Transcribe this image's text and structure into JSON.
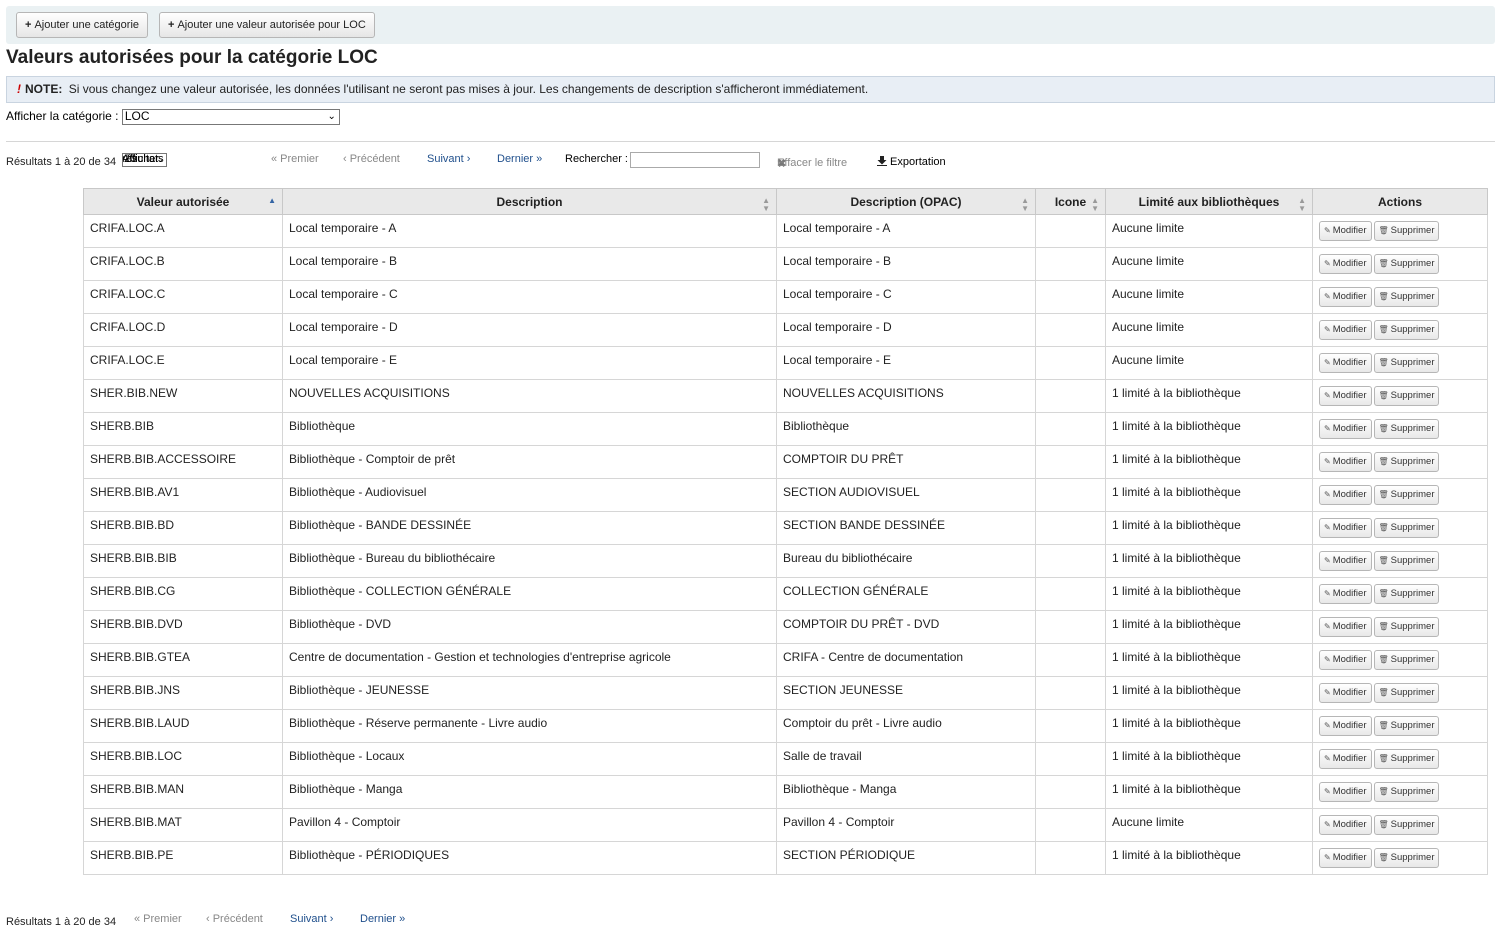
{
  "toolbar": {
    "add_category": "Ajouter une catégorie",
    "add_value": "Ajouter une valeur autorisée pour LOC"
  },
  "page_title": "Valeurs autorisées pour la catégorie LOC",
  "note": {
    "label": "NOTE:",
    "text": "Si vous changez une valeur autorisée, les données l'utilisant ne seront pas mises à jour. Les changements de description s'afficheront immédiatement."
  },
  "category": {
    "label": "Afficher la catégorie :",
    "selected": "LOC"
  },
  "pager": {
    "info": "Résultats 1 à 20 de 34",
    "show_label": "Afficher",
    "page_length": "20",
    "results_label": "résultats",
    "first": "« Premier",
    "previous": "‹ Précédent",
    "next": "Suivant ›",
    "last": "Dernier »",
    "search_label": "Rechercher :",
    "search_value": "",
    "clear_filter": "Effacer le filtre",
    "export": "Exportation"
  },
  "table": {
    "headers": [
      "Valeur autorisée",
      "Description",
      "Description (OPAC)",
      "Icone",
      "Limité aux bibliothèques",
      "Actions"
    ],
    "edit_label": "Modifier",
    "delete_label": "Supprimer",
    "rows": [
      [
        "CRIFA.LOC.A",
        "Local temporaire - A",
        "Local temporaire - A",
        "",
        "Aucune limite"
      ],
      [
        "CRIFA.LOC.B",
        "Local temporaire - B",
        "Local temporaire - B",
        "",
        "Aucune limite"
      ],
      [
        "CRIFA.LOC.C",
        "Local temporaire - C",
        "Local temporaire - C",
        "",
        "Aucune limite"
      ],
      [
        "CRIFA.LOC.D",
        "Local temporaire - D",
        "Local temporaire - D",
        "",
        "Aucune limite"
      ],
      [
        "CRIFA.LOC.E",
        "Local temporaire - E",
        "Local temporaire - E",
        "",
        "Aucune limite"
      ],
      [
        "SHER.BIB.NEW",
        "NOUVELLES ACQUISITIONS",
        "NOUVELLES ACQUISITIONS",
        "",
        "1 limité à la bibliothèque"
      ],
      [
        "SHERB.BIB",
        "Bibliothèque",
        "Bibliothèque",
        "",
        "1 limité à la bibliothèque"
      ],
      [
        "SHERB.BIB.ACCESSOIRE",
        "Bibliothèque - Comptoir de prêt",
        "COMPTOIR DU PRÊT",
        "",
        "1 limité à la bibliothèque"
      ],
      [
        "SHERB.BIB.AV1",
        "Bibliothèque - Audiovisuel",
        "SECTION AUDIOVISUEL",
        "",
        "1 limité à la bibliothèque"
      ],
      [
        "SHERB.BIB.BD",
        "Bibliothèque - BANDE DESSINÉE",
        "SECTION BANDE DESSINÉE",
        "",
        "1 limité à la bibliothèque"
      ],
      [
        "SHERB.BIB.BIB",
        "Bibliothèque - Bureau du bibliothécaire",
        "Bureau du bibliothécaire",
        "",
        "1 limité à la bibliothèque"
      ],
      [
        "SHERB.BIB.CG",
        "Bibliothèque - COLLECTION GÉNÉRALE",
        "COLLECTION GÉNÉRALE",
        "",
        "1 limité à la bibliothèque"
      ],
      [
        "SHERB.BIB.DVD",
        "Bibliothèque - DVD",
        "COMPTOIR DU PRÊT - DVD",
        "",
        "1 limité à la bibliothèque"
      ],
      [
        "SHERB.BIB.GTEA",
        "Centre de documentation - Gestion et technologies d'entreprise agricole",
        "CRIFA - Centre de documentation",
        "",
        "1 limité à la bibliothèque"
      ],
      [
        "SHERB.BIB.JNS",
        "Bibliothèque - JEUNESSE",
        "SECTION JEUNESSE",
        "",
        "1 limité à la bibliothèque"
      ],
      [
        "SHERB.BIB.LAUD",
        "Bibliothèque - Réserve permanente - Livre audio",
        "Comptoir du prêt - Livre audio",
        "",
        "1 limité à la bibliothèque"
      ],
      [
        "SHERB.BIB.LOC",
        "Bibliothèque - Locaux",
        "Salle de travail",
        "",
        "1 limité à la bibliothèque"
      ],
      [
        "SHERB.BIB.MAN",
        "Bibliothèque - Manga",
        "Bibliothèque - Manga",
        "",
        "1 limité à la bibliothèque"
      ],
      [
        "SHERB.BIB.MAT",
        "Pavillon 4 - Comptoir",
        "Pavillon 4 - Comptoir",
        "",
        "Aucune limite"
      ],
      [
        "SHERB.BIB.PE",
        "Bibliothèque - PÉRIODIQUES",
        "SECTION PÉRIODIQUE",
        "",
        "1 limité à la bibliothèque"
      ]
    ]
  }
}
